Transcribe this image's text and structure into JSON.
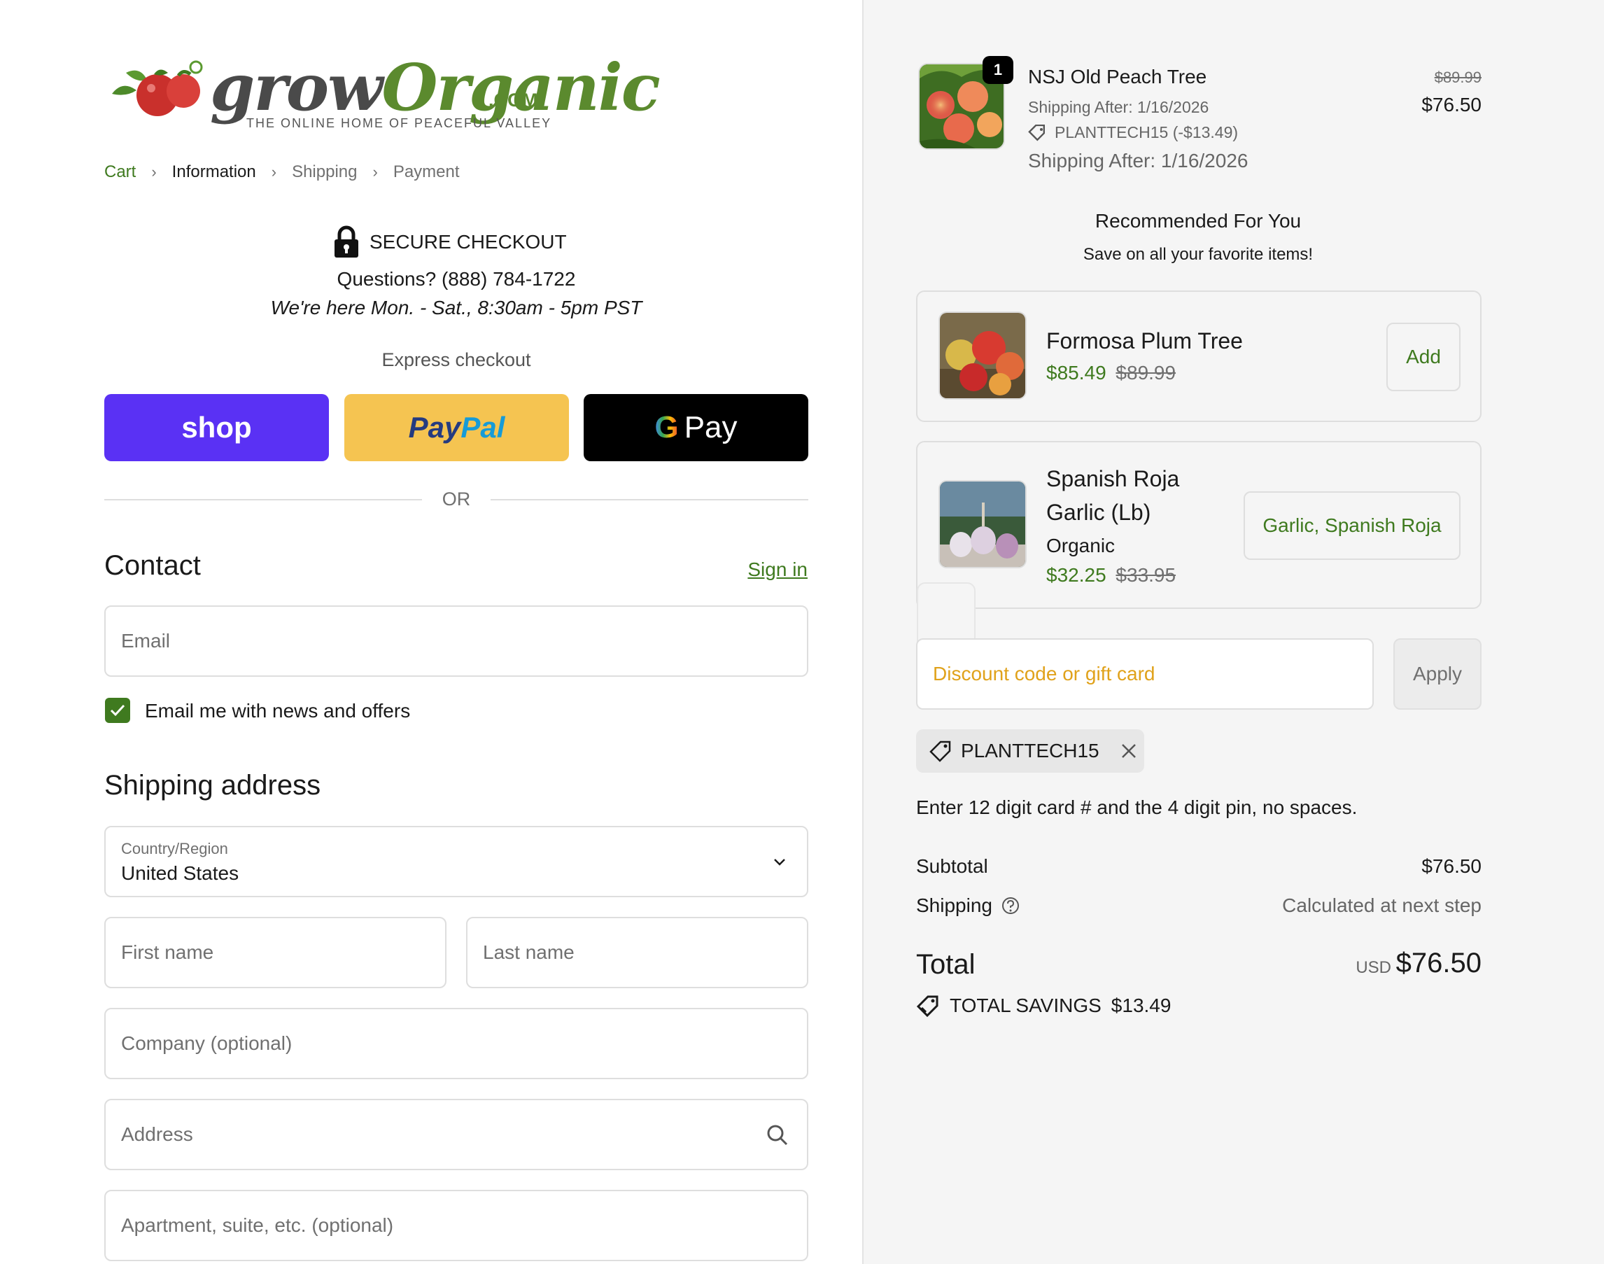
{
  "logo": {
    "grow": "grow",
    "organic": "Organic",
    "com": ".COM",
    "tagline": "THE ONLINE HOME OF PEACEFUL VALLEY"
  },
  "breadcrumb": [
    {
      "label": "Cart"
    },
    {
      "label": "Information"
    },
    {
      "label": "Shipping"
    },
    {
      "label": "Payment"
    }
  ],
  "secure": {
    "title": "SECURE CHECKOUT",
    "questions": "Questions? (888) 784-1722",
    "hours": "We're here Mon. - Sat., 8:30am - 5pm PST"
  },
  "express": {
    "label": "Express checkout",
    "shop": "shop",
    "paypal_1": "Pay",
    "paypal_2": "Pal",
    "gpay_g": "G",
    "gpay_pay": "Pay",
    "or": "OR"
  },
  "contact": {
    "heading": "Contact",
    "sign_in": "Sign in",
    "email_placeholder": "Email",
    "newsletter_label": "Email me with news and offers",
    "newsletter_checked": true
  },
  "shipping": {
    "heading": "Shipping address",
    "country_label": "Country/Region",
    "country_value": "United States",
    "first_name": "First name",
    "last_name": "Last name",
    "company": "Company (optional)",
    "address": "Address",
    "apartment": "Apartment, suite, etc. (optional)"
  },
  "cart_item": {
    "quantity": "1",
    "name": "NSJ Old Peach Tree",
    "shipping_after_small": "Shipping After: 1/16/2026",
    "discount": "PLANTTECH15 (-$13.49)",
    "shipping_after_large": "Shipping After: 1/16/2026",
    "original_price": "$89.99",
    "price": "$76.50"
  },
  "recommended": {
    "title": "Recommended For You",
    "subtitle": "Save on all your favorite items!",
    "items": [
      {
        "name": "Formosa Plum Tree",
        "price": "$85.49",
        "original": "$89.99",
        "button": "Add"
      },
      {
        "name_line1": "Spanish Roja",
        "name_line2": "Garlic (Lb)",
        "variant": "Organic",
        "price": "$32.25",
        "original": "$33.95",
        "button": "Garlic, Spanish Roja"
      }
    ]
  },
  "discount": {
    "placeholder": "Discount code or gift card",
    "apply": "Apply",
    "applied_code": "PLANTTECH15",
    "card_note": "Enter 12 digit card # and the 4 digit pin, no spaces."
  },
  "summary": {
    "subtotal_label": "Subtotal",
    "subtotal_value": "$76.50",
    "shipping_label": "Shipping",
    "shipping_value": "Calculated at next step",
    "total_label": "Total",
    "currency": "USD",
    "total_value": "$76.50",
    "savings_label": "TOTAL SAVINGS",
    "savings_value": "$13.49"
  },
  "colors": {
    "brand_green": "#3f7a1f",
    "shop_purple": "#5a31f4",
    "paypal_yellow": "#f5c451",
    "discount_orange": "#e0a21b"
  }
}
